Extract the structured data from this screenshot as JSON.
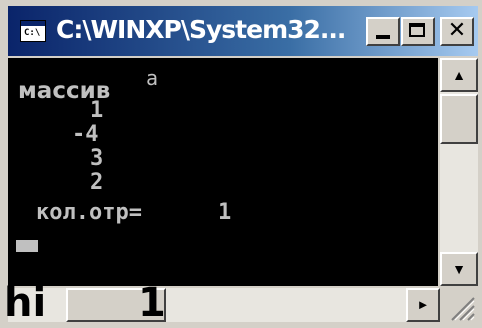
{
  "window": {
    "title": "C:\\WINXP\\System32...",
    "icon_label": "C:\\",
    "icons": [
      "console-window-icon",
      "minimize-icon",
      "maximize-icon",
      "close-icon"
    ]
  },
  "console": {
    "lines": [
      {
        "text": "массив",
        "stray": "a"
      },
      {
        "text": "1"
      },
      {
        "text": "-4"
      },
      {
        "text": "3"
      },
      {
        "text": "2"
      },
      {
        "text": "кол.отр=",
        "value": "1"
      }
    ]
  },
  "scrollbar": {
    "up_arrow": "▲",
    "down_arrow": "▼",
    "right_arrow": "►"
  },
  "overlay": {
    "left_text": "hi",
    "right_text": "1"
  },
  "colors": {
    "title_gradient_start": "#0a246a",
    "title_gradient_end": "#a6caf0",
    "console_bg": "#000000",
    "console_text": "#c0c0c0",
    "chrome": "#d4d0c8"
  }
}
